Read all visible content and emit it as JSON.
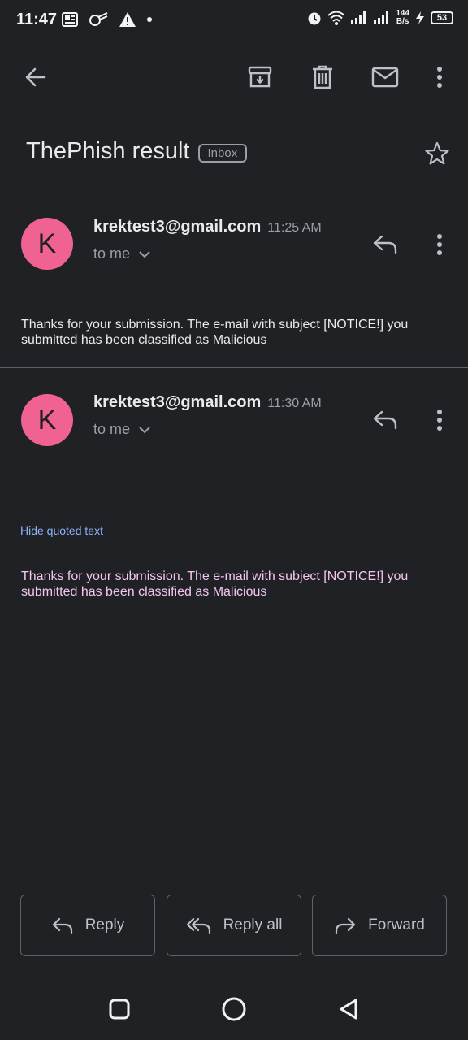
{
  "status_bar": {
    "time": "11:47",
    "net_speed_value": "144",
    "net_speed_unit": "B/s",
    "battery": "53"
  },
  "toolbar": {
    "icons": [
      "arrow-back-icon",
      "archive-icon",
      "delete-icon",
      "mail-icon",
      "more-vert-icon"
    ]
  },
  "subject": {
    "title": "ThePhish result",
    "label": "Inbox"
  },
  "messages": [
    {
      "avatar_letter": "K",
      "sender": "krektest3@gmail.com",
      "time": "11:25 AM",
      "to": "to me",
      "body": "Thanks for your submission. The e-mail with subject [NOTICE!] you submitted has been classified as Malicious",
      "body_color": "#e8eaed"
    },
    {
      "avatar_letter": "K",
      "sender": "krektest3@gmail.com",
      "time": "11:30 AM",
      "to": "to me",
      "hide_quoted": "Hide quoted text",
      "body": "Thanks for your submission. The e-mail with subject [NOTICE!] you submitted has been classified as Malicious",
      "body_color": "#f3c6f0"
    }
  ],
  "actions": {
    "reply": "Reply",
    "reply_all": "Reply all",
    "forward": "Forward"
  },
  "colors": {
    "background": "#202124",
    "avatar": "#f06292",
    "link": "#8ab4f8"
  }
}
